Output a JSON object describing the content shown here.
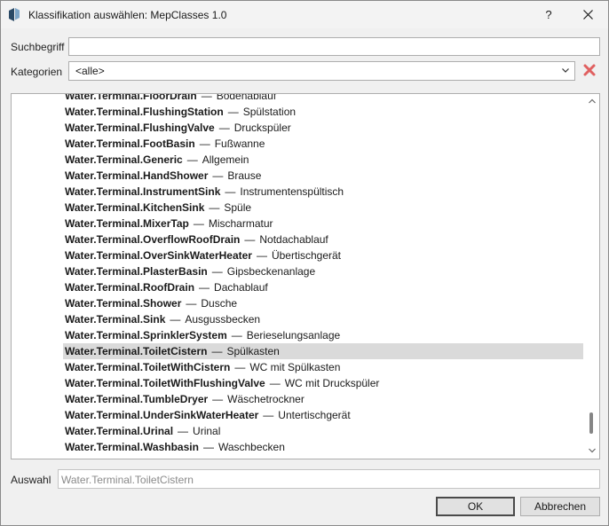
{
  "window": {
    "title": "Klassifikation auswählen: MepClasses 1.0",
    "help_label": "?",
    "close_label": "✕"
  },
  "form": {
    "search_label": "Suchbegriff",
    "search_value": "",
    "category_label": "Kategorien",
    "category_value": "<alle>",
    "selection_label": "Auswahl",
    "selection_value": "Water.Terminal.ToiletCistern"
  },
  "list": {
    "separator": "—",
    "selected_index": 16,
    "items": [
      {
        "code": "Water.Terminal.FloorDrain",
        "name": "Bodenablauf"
      },
      {
        "code": "Water.Terminal.FlushingStation",
        "name": "Spülstation"
      },
      {
        "code": "Water.Terminal.FlushingValve",
        "name": "Druckspüler"
      },
      {
        "code": "Water.Terminal.FootBasin",
        "name": "Fußwanne"
      },
      {
        "code": "Water.Terminal.Generic",
        "name": "Allgemein"
      },
      {
        "code": "Water.Terminal.HandShower",
        "name": "Brause"
      },
      {
        "code": "Water.Terminal.InstrumentSink",
        "name": "Instrumentenspültisch"
      },
      {
        "code": "Water.Terminal.KitchenSink",
        "name": "Spüle"
      },
      {
        "code": "Water.Terminal.MixerTap",
        "name": "Mischarmatur"
      },
      {
        "code": "Water.Terminal.OverflowRoofDrain",
        "name": "Notdachablauf"
      },
      {
        "code": "Water.Terminal.OverSinkWaterHeater",
        "name": "Übertischgerät"
      },
      {
        "code": "Water.Terminal.PlasterBasin",
        "name": "Gipsbeckenanlage"
      },
      {
        "code": "Water.Terminal.RoofDrain",
        "name": "Dachablauf"
      },
      {
        "code": "Water.Terminal.Shower",
        "name": "Dusche"
      },
      {
        "code": "Water.Terminal.Sink",
        "name": "Ausgussbecken"
      },
      {
        "code": "Water.Terminal.SprinklerSystem",
        "name": "Berieselungsanlage"
      },
      {
        "code": "Water.Terminal.ToiletCistern",
        "name": "Spülkasten"
      },
      {
        "code": "Water.Terminal.ToiletWithCistern",
        "name": "WC mit Spülkasten"
      },
      {
        "code": "Water.Terminal.ToiletWithFlushingValve",
        "name": "WC mit Druckspüler"
      },
      {
        "code": "Water.Terminal.TumbleDryer",
        "name": "Wäschetrockner"
      },
      {
        "code": "Water.Terminal.UnderSinkWaterHeater",
        "name": "Untertischgerät"
      },
      {
        "code": "Water.Terminal.Urinal",
        "name": "Urinal"
      },
      {
        "code": "Water.Terminal.Washbasin",
        "name": "Waschbecken"
      }
    ]
  },
  "buttons": {
    "ok_label": "OK",
    "cancel_label": "Abbrechen"
  },
  "icons": {
    "app": "app-logo-icon",
    "dropdown": "chevron-down-icon",
    "clear": "clear-x-icon",
    "scroll_up": "scroll-up-arrow-icon",
    "scroll_down": "scroll-down-arrow-icon"
  },
  "colors": {
    "selection_bg": "#dadada",
    "clear_icon": "#e06060",
    "app_icon": "#2b4a66"
  }
}
